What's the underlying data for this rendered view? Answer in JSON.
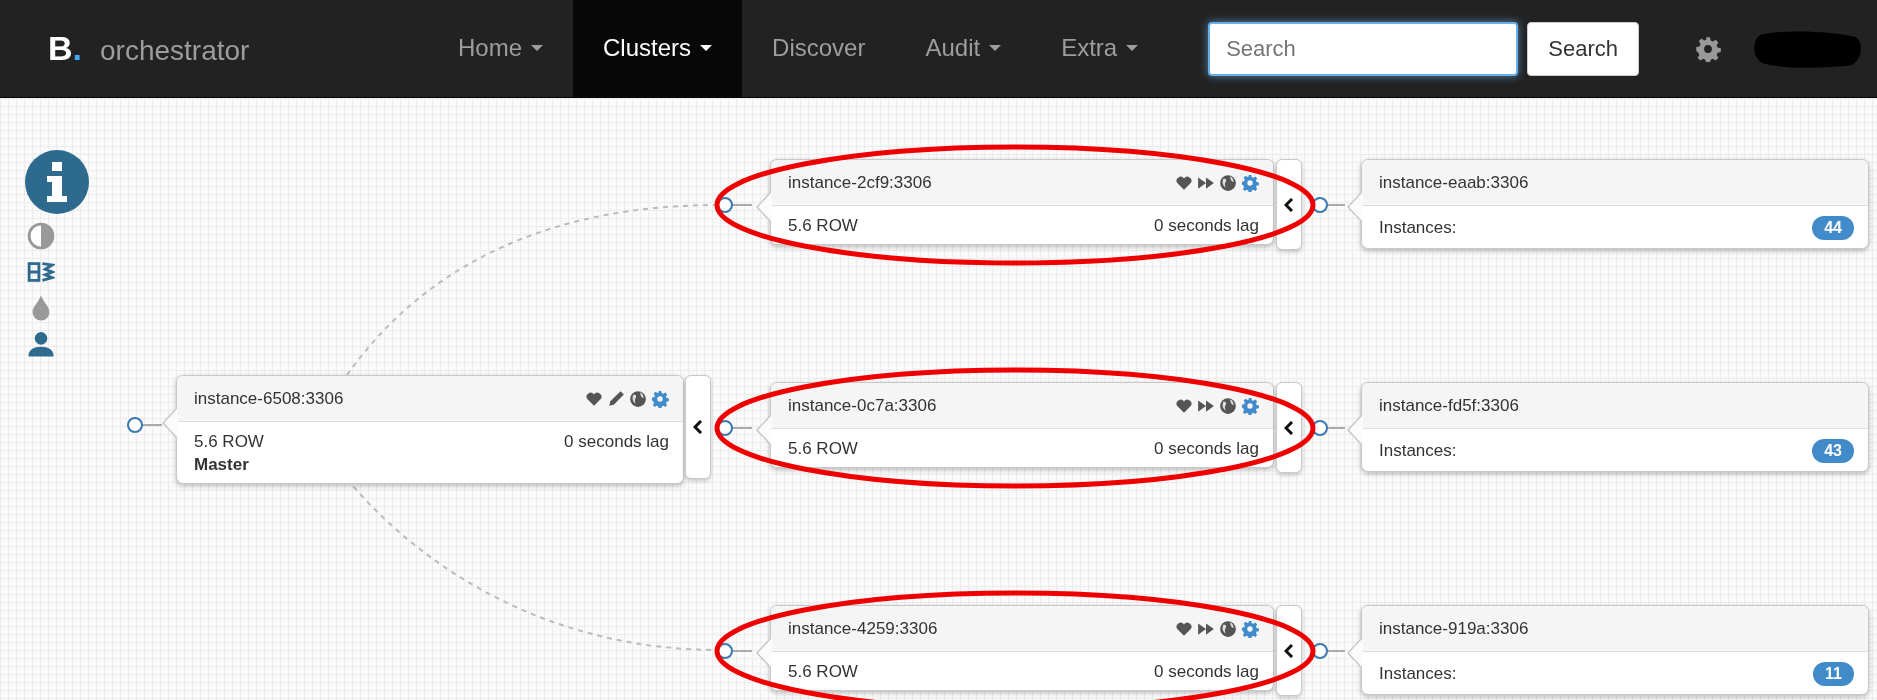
{
  "navbar": {
    "logo": {
      "letter": "B",
      "dot": "."
    },
    "title": "orchestrator",
    "menu": [
      {
        "label": "Home",
        "dropdown": true,
        "selected": false
      },
      {
        "label": "Clusters",
        "dropdown": true,
        "selected": true
      },
      {
        "label": "Discover",
        "dropdown": false,
        "selected": false
      },
      {
        "label": "Audit",
        "dropdown": true,
        "selected": false
      },
      {
        "label": "Extra",
        "dropdown": true,
        "selected": false
      }
    ],
    "search": {
      "placeholder": "Search",
      "button": "Search"
    }
  },
  "topology": {
    "master": {
      "kind": "master",
      "host": "instance-6508:3306",
      "version": "5.6 ROW",
      "lag": "0 seconds lag",
      "role": "Master"
    },
    "replicas": [
      {
        "kind": "replica",
        "host": "instance-2cf9:3306",
        "version": "5.6 ROW",
        "lag": "0 seconds lag",
        "highlighted": true,
        "downstream": {
          "host": "instance-eaab:3306",
          "label": "Instances:",
          "count": "44"
        }
      },
      {
        "kind": "replica",
        "host": "instance-0c7a:3306",
        "version": "5.6 ROW",
        "lag": "0 seconds lag",
        "highlighted": true,
        "downstream": {
          "host": "instance-fd5f:3306",
          "label": "Instances:",
          "count": "43"
        }
      },
      {
        "kind": "replica",
        "host": "instance-4259:3306",
        "version": "5.6 ROW",
        "lag": "0 seconds lag",
        "highlighted": true,
        "downstream": {
          "host": "instance-919a:3306",
          "label": "Instances:",
          "count": "11"
        }
      }
    ]
  }
}
